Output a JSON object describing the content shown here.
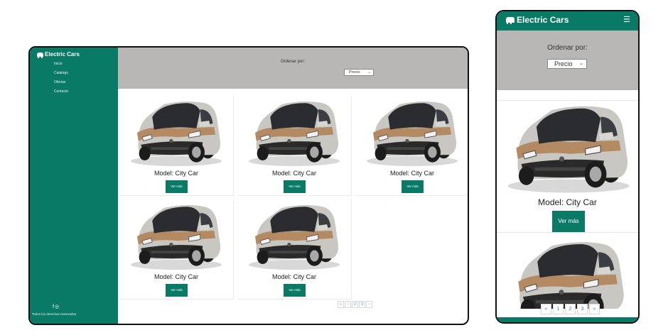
{
  "brand": {
    "name": "Electric Cars",
    "color": "#087a66"
  },
  "nav": [
    "Inicio",
    "Catalogo",
    "Ofertas",
    "Contacto"
  ],
  "filter": {
    "label": "Ordenar por:",
    "selected": "Precio"
  },
  "products": [
    {
      "model": "Model: City Car",
      "button": "Ver más"
    },
    {
      "model": "Model: City Car",
      "button": "Ver más"
    },
    {
      "model": "Model: City Car",
      "button": "Ver más"
    },
    {
      "model": "Model: City Car",
      "button": "Ver más"
    },
    {
      "model": "Model: City Car",
      "button": "Ver más"
    }
  ],
  "pagination": [
    "«",
    "‹",
    "2",
    "3",
    "›"
  ],
  "mobile_pagination": [
    "«",
    "1",
    "2",
    "3",
    "»"
  ],
  "footer": {
    "social_icons": [
      "facebook-icon",
      "instagram-icon"
    ],
    "copyright": "Todos los derechos reservados"
  },
  "mobile": {
    "menu_icon": "☰",
    "model": "Model: City Car",
    "button": "Ver más"
  }
}
